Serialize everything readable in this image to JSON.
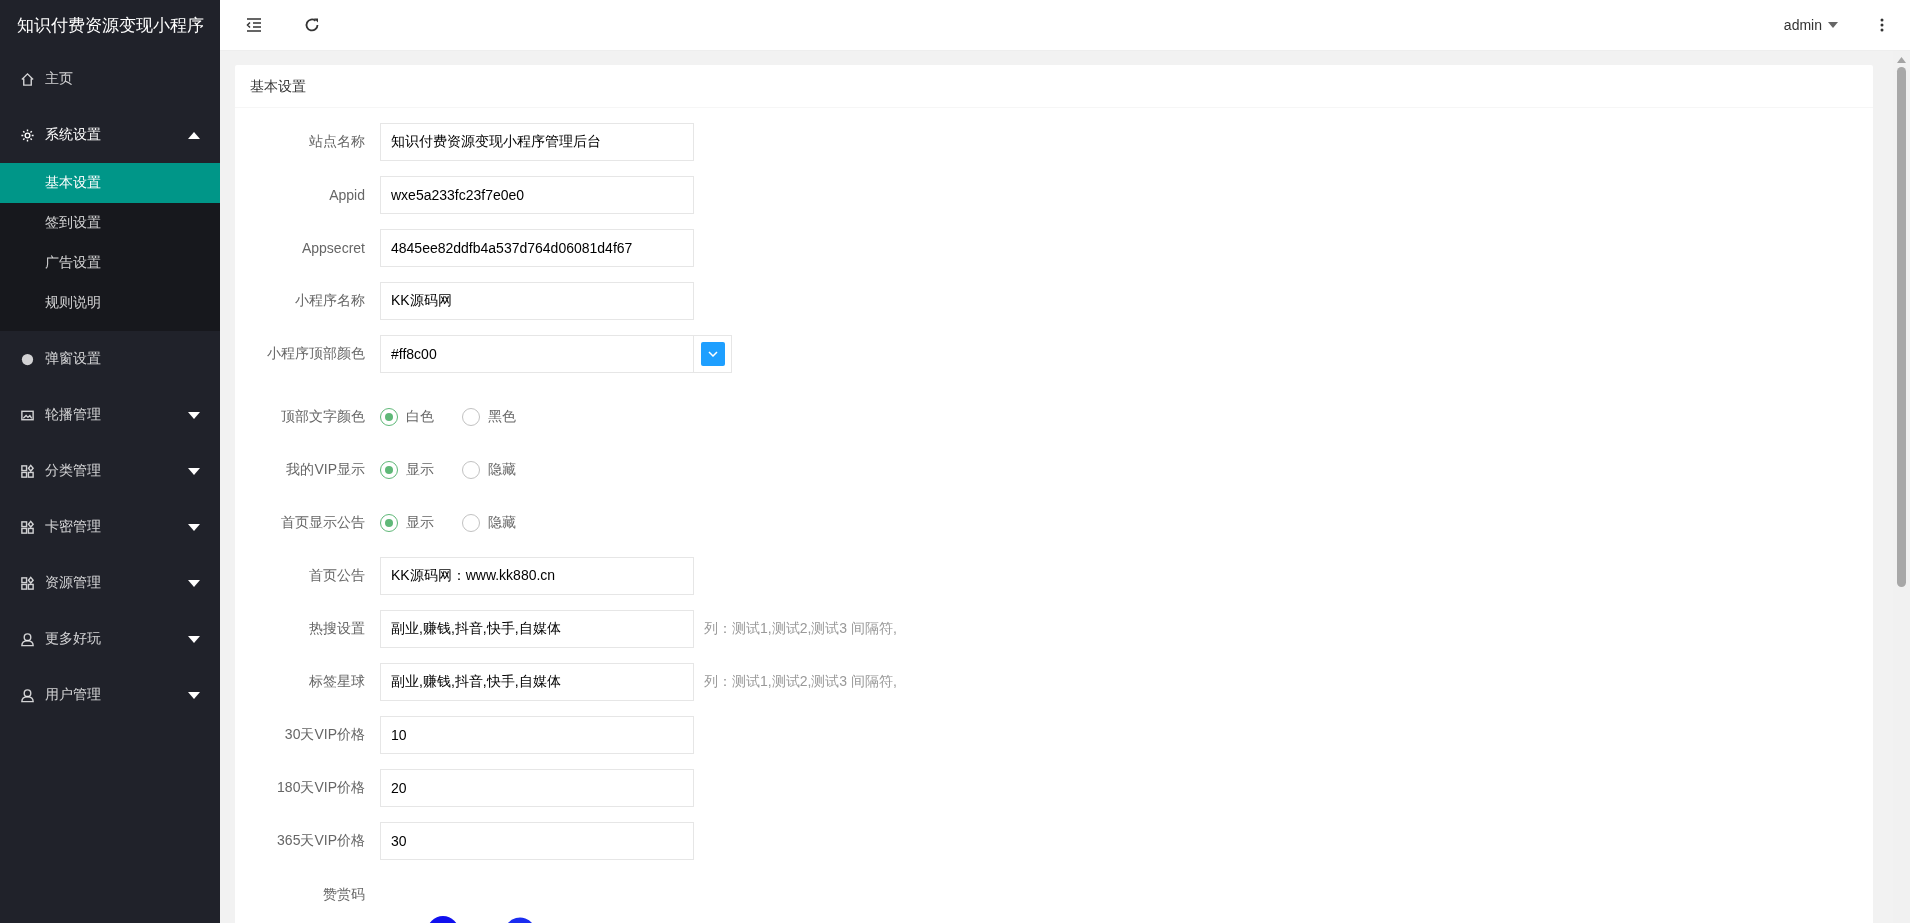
{
  "sidebar": {
    "title": "知识付费资源变现小程序",
    "items": [
      {
        "label": "主页"
      },
      {
        "label": "系统设置",
        "expanded": true,
        "children": [
          {
            "label": "基本设置",
            "selected": true
          },
          {
            "label": "签到设置",
            "selected": false
          },
          {
            "label": "广告设置",
            "selected": false
          },
          {
            "label": "规则说明",
            "selected": false
          }
        ]
      },
      {
        "label": "弹窗设置"
      },
      {
        "label": "轮播管理",
        "expanded": false
      },
      {
        "label": "分类管理",
        "expanded": false
      },
      {
        "label": "卡密管理",
        "expanded": false
      },
      {
        "label": "资源管理",
        "expanded": false
      },
      {
        "label": "更多好玩",
        "expanded": false
      },
      {
        "label": "用户管理",
        "expanded": false
      }
    ]
  },
  "header": {
    "user": "admin"
  },
  "card": {
    "title": "基本设置",
    "fields": [
      {
        "kind": "text",
        "label": "站点名称",
        "value": "知识付费资源变现小程序管理后台"
      },
      {
        "kind": "text",
        "label": "Appid",
        "value": "wxe5a233fc23f7e0e0"
      },
      {
        "kind": "text",
        "label": "Appsecret",
        "value": "4845ee82ddfb4a537d764d06081d4f67"
      },
      {
        "kind": "text",
        "label": "小程序名称",
        "value": "KK源码网"
      },
      {
        "kind": "color",
        "label": "小程序顶部颜色",
        "value": "#ff8c00"
      },
      {
        "kind": "radio",
        "label": "顶部文字颜色",
        "options": [
          {
            "label": "白色",
            "selected": true
          },
          {
            "label": "黑色",
            "selected": false
          }
        ]
      },
      {
        "kind": "radio",
        "label": "我的VIP显示",
        "options": [
          {
            "label": "显示",
            "selected": true
          },
          {
            "label": "隐藏",
            "selected": false
          }
        ]
      },
      {
        "kind": "radio",
        "label": "首页显示公告",
        "options": [
          {
            "label": "显示",
            "selected": true
          },
          {
            "label": "隐藏",
            "selected": false
          }
        ]
      },
      {
        "kind": "text",
        "label": "首页公告",
        "value": "KK源码网：www.kk880.cn"
      },
      {
        "kind": "text",
        "label": "热搜设置",
        "value": "副业,赚钱,抖音,快手,自媒体",
        "hint": "列：测试1,测试2,测试3 间隔符,"
      },
      {
        "kind": "text",
        "label": "标签星球",
        "value": "副业,赚钱,抖音,快手,自媒体",
        "hint": "列：测试1,测试2,测试3 间隔符,"
      },
      {
        "kind": "text",
        "label": "30天VIP价格",
        "value": "10"
      },
      {
        "kind": "text",
        "label": "180天VIP价格",
        "value": "20"
      },
      {
        "kind": "text",
        "label": "365天VIP价格",
        "value": "30"
      },
      {
        "kind": "image",
        "label": "赞赏码"
      }
    ]
  }
}
